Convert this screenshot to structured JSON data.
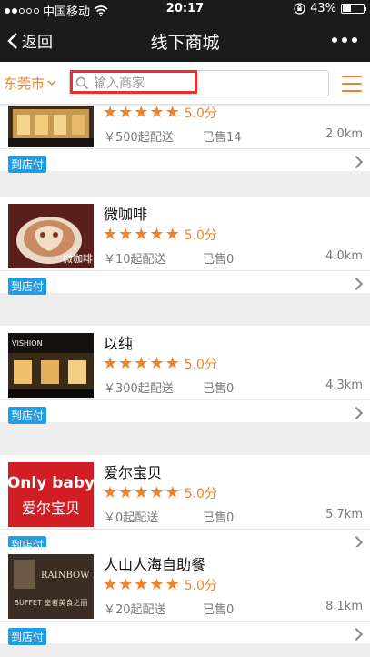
{
  "status": {
    "carrier": "中国移动",
    "time": "20:17",
    "battery": "43%",
    "battery_level": 0.43
  },
  "nav": {
    "back_label": "返回",
    "title": "线下商城"
  },
  "search": {
    "city": "东莞市",
    "placeholder": "输入商家"
  },
  "stores": [
    {
      "name": "",
      "rating": "5.0分",
      "min_order": "￥500起配送",
      "sold": "已售14",
      "distance": "2.0km",
      "badge": "到店付"
    },
    {
      "name": "微咖啡",
      "rating": "5.0分",
      "min_order": "￥10起配送",
      "sold": "已售0",
      "distance": "4.0km",
      "badge": "到店付",
      "thumb_text": "微咖啡"
    },
    {
      "name": "以纯",
      "rating": "5.0分",
      "min_order": "￥300起配送",
      "sold": "已售0",
      "distance": "4.3km",
      "badge": "到店付",
      "thumb_text": "VISHION"
    },
    {
      "name": "爱尔宝贝",
      "rating": "5.0分",
      "min_order": "￥0起配送",
      "sold": "已售0",
      "distance": "5.7km",
      "badge": "到店付",
      "thumb_text": "Only baby",
      "thumb_text2": "爱尔宝贝"
    },
    {
      "name": "人山人海自助餐",
      "rating": "5.0分",
      "min_order": "￥20起配送",
      "sold": "已售0",
      "distance": "8.1km",
      "badge": "到店付",
      "thumb_text": "RAINBOW BUFFET",
      "thumb_text2": "BUFFET 皇者美食之丽"
    }
  ],
  "colors": {
    "accent": "#f0832a",
    "badge": "#1f9ee6",
    "bar": "#1b1b1b",
    "highlight": "#e8312f"
  }
}
